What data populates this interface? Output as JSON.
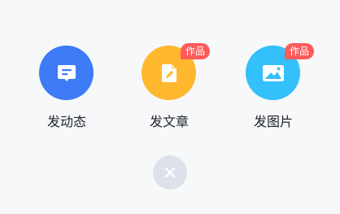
{
  "colors": {
    "background": "#f7f8fa",
    "post_moment": "#3d7bf7",
    "post_article": "#ffb82e",
    "post_image": "#33c0fb",
    "badge": "#ff5a5a",
    "close_button": "#dde1ea",
    "close_glyph": "#ffffff",
    "label_text": "#1f2329"
  },
  "actions": [
    {
      "label": "发动态",
      "icon": "message-list-icon",
      "badge": null
    },
    {
      "label": "发文章",
      "icon": "edit-document-icon",
      "badge": "作品"
    },
    {
      "label": "发图片",
      "icon": "image-icon",
      "badge": "作品"
    }
  ],
  "close": {
    "icon": "close-icon",
    "glyph": "×"
  }
}
